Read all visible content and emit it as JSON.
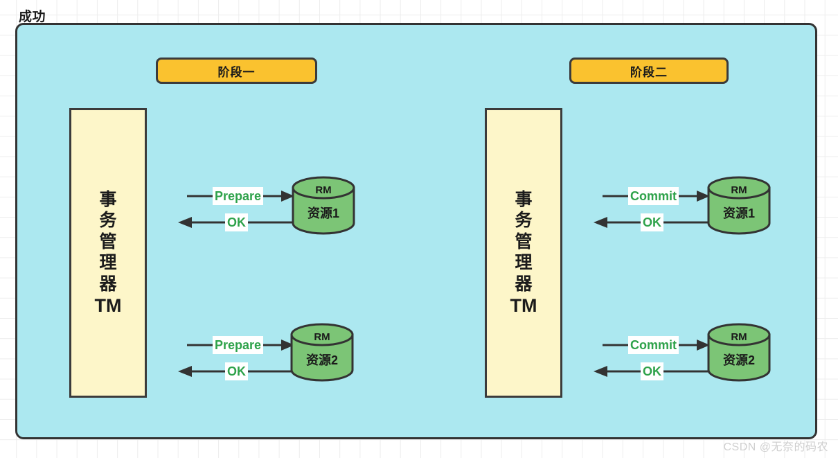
{
  "diagram": {
    "title": "成功",
    "container_fill": "#ace8f0",
    "container_border": "#333333"
  },
  "phases": [
    {
      "pill_label": "阶段一",
      "pill_fill": "#fac22f",
      "tm": {
        "vertical_chars": [
          "事",
          "务",
          "管",
          "理",
          "器"
        ],
        "latin_label": "TM",
        "fill": "#fdf6c9"
      },
      "resources": [
        {
          "top_label": "RM",
          "body_label": "资源1",
          "fill": "#7cc576",
          "request_label": "Prepare",
          "response_label": "OK"
        },
        {
          "top_label": "RM",
          "body_label": "资源2",
          "fill": "#7cc576",
          "request_label": "Prepare",
          "response_label": "OK"
        }
      ]
    },
    {
      "pill_label": "阶段二",
      "pill_fill": "#fac22f",
      "tm": {
        "vertical_chars": [
          "事",
          "务",
          "管",
          "理",
          "器"
        ],
        "latin_label": "TM",
        "fill": "#fdf6c9"
      },
      "resources": [
        {
          "top_label": "RM",
          "body_label": "资源1",
          "fill": "#7cc576",
          "request_label": "Commit",
          "response_label": "OK"
        },
        {
          "top_label": "RM",
          "body_label": "资源2",
          "fill": "#7cc576",
          "request_label": "Commit",
          "response_label": "OK"
        }
      ]
    }
  ],
  "label_color": "#2ea24a",
  "watermark": "CSDN @无奈的码农"
}
